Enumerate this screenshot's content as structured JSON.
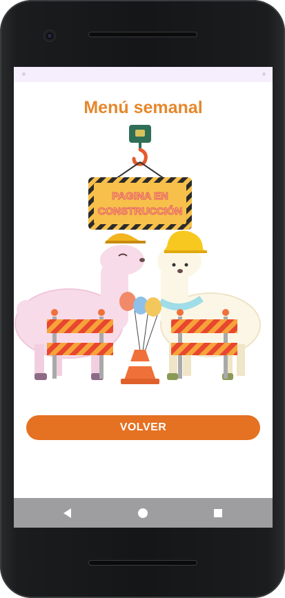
{
  "screen": {
    "title": "Menú semanal",
    "sign_text_line1": "PAGINA EN",
    "sign_text_line2": "CONSTRUCCIÓN",
    "back_button_label": "VOLVER"
  },
  "illustration": {
    "description_icons": [
      "crane-hook-icon",
      "construction-sign",
      "llama-left",
      "llama-right",
      "barrier-left",
      "barrier-right",
      "traffic-cone",
      "balloons"
    ]
  },
  "colors": {
    "title": "#e5872b",
    "button": "#e57122",
    "status_bar": "#f6eefc",
    "nav_bar": "#9e9d9f",
    "sign_yellow": "#f7c04a"
  },
  "system_nav": {
    "back": "back-triangle-icon",
    "home": "home-circle-icon",
    "recents": "recents-square-icon"
  }
}
